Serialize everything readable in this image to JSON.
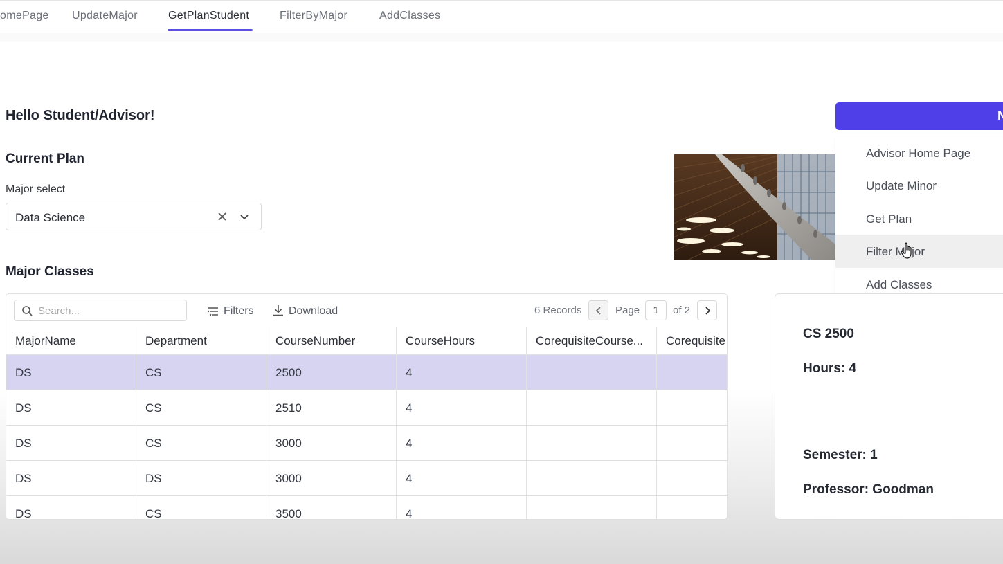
{
  "nav": {
    "tabs": [
      {
        "label": "omePage"
      },
      {
        "label": "UpdateMajor"
      },
      {
        "label": "GetPlanStudent"
      },
      {
        "label": "FilterByMajor"
      },
      {
        "label": "AddClasses"
      }
    ],
    "active_tab": "GetPlanStudent",
    "accent_color": "#5a4fe0"
  },
  "greeting": "Hello Student/Advisor!",
  "current_plan": {
    "heading": "Current Plan",
    "major_label": "Major select",
    "major_value": "Data Science"
  },
  "major_classes": {
    "heading": "Major Classes",
    "search_placeholder": "Search...",
    "filters_label": "Filters",
    "download_label": "Download",
    "records_text": "6 Records",
    "page_label": "Page",
    "page_current": "1",
    "page_of": "of 2",
    "columns": [
      "MajorName",
      "Department",
      "CourseNumber",
      "CourseHours",
      "CorequisiteCourse...",
      "Corequisite"
    ],
    "rows": [
      [
        "DS",
        "CS",
        "2500",
        "4",
        "",
        ""
      ],
      [
        "DS",
        "CS",
        "2510",
        "4",
        "",
        ""
      ],
      [
        "DS",
        "CS",
        "3000",
        "4",
        "",
        ""
      ],
      [
        "DS",
        "DS",
        "3000",
        "4",
        "",
        ""
      ],
      [
        "DS",
        "CS",
        "3500",
        "4",
        "",
        ""
      ]
    ],
    "selected_row_color": "#d6d4f1"
  },
  "menu_button": {
    "label": "N",
    "color": "#4f3fe8"
  },
  "dropdown": {
    "items": [
      "Advisor Home Page",
      "Update Minor",
      "Get Plan",
      "Filter Major",
      "Add Classes"
    ],
    "hovered_item": "Filter Major"
  },
  "course_detail": {
    "course": "CS 2500",
    "hours": "Hours: 4",
    "semester": "Semester: 1",
    "professor": "Professor: Goodman"
  }
}
